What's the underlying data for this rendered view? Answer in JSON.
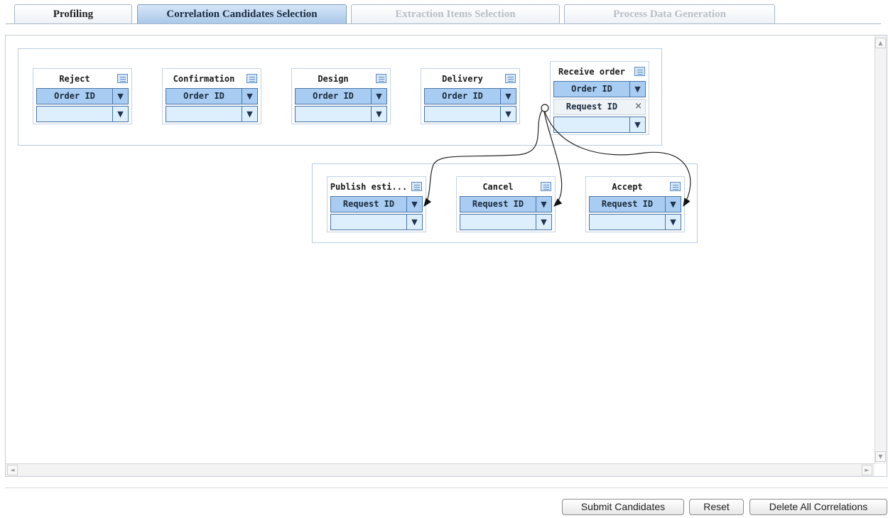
{
  "tabs": [
    {
      "label": "Profiling",
      "state": "normal"
    },
    {
      "label": "Correlation Candidates Selection",
      "state": "active"
    },
    {
      "label": "Extraction Items Selection",
      "state": "disabled"
    },
    {
      "label": "Process Data Generation",
      "state": "disabled"
    }
  ],
  "top_nodes": [
    {
      "title": "Reject",
      "rows": [
        "Order ID",
        ""
      ]
    },
    {
      "title": "Confirmation",
      "rows": [
        "Order ID",
        ""
      ]
    },
    {
      "title": "Design",
      "rows": [
        "Order ID",
        ""
      ]
    },
    {
      "title": "Delivery",
      "rows": [
        "Order ID",
        ""
      ]
    },
    {
      "title": "Receive order",
      "rows": [
        "Order ID",
        "Request ID",
        ""
      ]
    }
  ],
  "bottom_nodes": [
    {
      "title": "Publish esti...",
      "rows": [
        "Request ID",
        ""
      ]
    },
    {
      "title": "Cancel",
      "rows": [
        "Request ID",
        ""
      ]
    },
    {
      "title": "Accept",
      "rows": [
        "Request ID",
        ""
      ]
    }
  ],
  "icons": {
    "table": "table-icon",
    "dropdown": "▼",
    "remove": "×",
    "scroll_up": "▲",
    "scroll_down": "▼",
    "scroll_left": "◄",
    "scroll_right": "►"
  },
  "buttons": {
    "submit": "Submit Candidates",
    "reset": "Reset",
    "delete_all": "Delete All Correlations"
  },
  "colors": {
    "active_tab": "#a9c8ea",
    "row_filled": "#a9cdf2",
    "row_empty": "#ddeefc",
    "border": "#4a76a8"
  }
}
